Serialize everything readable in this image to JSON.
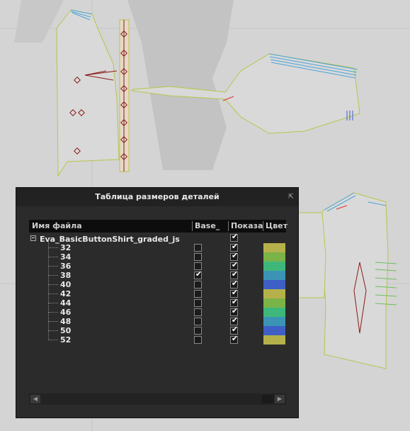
{
  "panel": {
    "title": "Таблица размеров деталей",
    "pin_icon": "pin-icon"
  },
  "columns": {
    "name": "Имя файла",
    "base": "Base_",
    "show": "Показа",
    "color": "Цвет"
  },
  "tree": {
    "root": "Eva_BasicButtonShirt_graded_js",
    "root_show": true,
    "sizes": [
      {
        "label": "32",
        "base": false,
        "show": true,
        "color": "#b5b14a"
      },
      {
        "label": "34",
        "base": false,
        "show": true,
        "color": "#7ab348"
      },
      {
        "label": "36",
        "base": false,
        "show": true,
        "color": "#3db87a"
      },
      {
        "label": "38",
        "base": true,
        "show": true,
        "color": "#3b94b5"
      },
      {
        "label": "40",
        "base": false,
        "show": true,
        "color": "#3d5fc6"
      },
      {
        "label": "42",
        "base": false,
        "show": true,
        "color": "#b5b14a"
      },
      {
        "label": "44",
        "base": false,
        "show": true,
        "color": "#7ab348"
      },
      {
        "label": "46",
        "base": false,
        "show": true,
        "color": "#3db87a"
      },
      {
        "label": "48",
        "base": false,
        "show": true,
        "color": "#3b94b5"
      },
      {
        "label": "50",
        "base": false,
        "show": true,
        "color": "#3d5fc6"
      },
      {
        "label": "52",
        "base": false,
        "show": true,
        "color": "#b5b14a"
      }
    ]
  },
  "colors": {
    "canvas_bg": "#d4d4d4",
    "piece_fill": "#d9d9d9",
    "piece_outline": "#b9c44a",
    "grading_lines": [
      "#4aa3d9",
      "#6bbf5b",
      "#3b5bc9"
    ],
    "notch_markers": "#8b1a1a",
    "panel_bg": "#2b2b2b"
  }
}
